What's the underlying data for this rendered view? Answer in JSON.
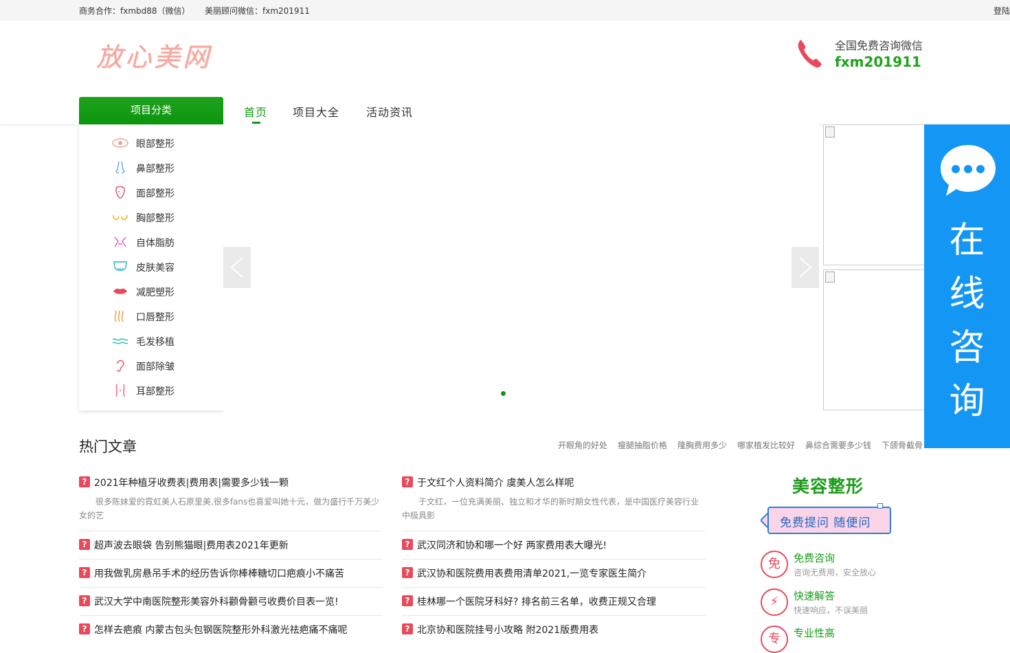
{
  "topbar": {
    "business": "商务合作：fxmbd88（微信）",
    "advisor": "美丽顾问微信：fxm201911",
    "login": "登陆"
  },
  "brand": {
    "logo_text": "放心美网"
  },
  "hotline": {
    "label": "全国免费咨询微信",
    "value": "fxm201911",
    "icon": "phone-icon"
  },
  "nav": {
    "category_head": "项目分类",
    "items": [
      {
        "label": "首页",
        "active": true
      },
      {
        "label": "项目大全",
        "active": false
      },
      {
        "label": "活动资讯",
        "active": false
      }
    ]
  },
  "categories": [
    {
      "label": "眼部整形",
      "icon": "eye-icon"
    },
    {
      "label": "鼻部整形",
      "icon": "nose-icon"
    },
    {
      "label": "面部整形",
      "icon": "face-icon"
    },
    {
      "label": "胸部整形",
      "icon": "chest-icon"
    },
    {
      "label": "自体脂肪",
      "icon": "body-fat-icon"
    },
    {
      "label": "皮肤美容",
      "icon": "skin-icon"
    },
    {
      "label": "减肥塑形",
      "icon": "lips-icon"
    },
    {
      "label": "口唇整形",
      "icon": "wave-icon"
    },
    {
      "label": "毛发移植",
      "icon": "hair-icon"
    },
    {
      "label": "面部除皱",
      "icon": "ear-icon"
    },
    {
      "label": "耳部整形",
      "icon": "figure-icon"
    }
  ],
  "float_consult": {
    "text": [
      "在",
      "线",
      "咨",
      "询"
    ],
    "icon": "chat-bubble-icon"
  },
  "hot": {
    "title": "热门文章",
    "tags": [
      "开眼角的好处",
      "瘦腿抽脂价格",
      "隆胸费用多少",
      "哪家植发比较好",
      "鼻综合需要多少钱",
      "下颌骨截骨"
    ]
  },
  "articles_left": [
    {
      "title": "2021年种植牙收费表|费用表|需要多少钱一颗",
      "desc": "很多陈妹爱的霓虹美人石原里美,很多fans也喜爱叫她十元，做为盛行千万美少女的艺"
    },
    {
      "title": "超声波去眼袋 告别熊猫眼|费用表2021年更新",
      "desc": ""
    },
    {
      "title": "用我做乳房悬吊手术的经历告诉你棒棒糖切口疤痕小不痛苦",
      "desc": ""
    },
    {
      "title": "武汉大学中南医院整形美容外科颧骨颧弓收费价目表一览!",
      "desc": ""
    },
    {
      "title": "怎样去疤痕 内蒙古包头包钢医院整形外科激光祛疤痛不痛呢",
      "desc": ""
    }
  ],
  "articles_right": [
    {
      "title": "于文红个人资料简介 虞美人怎么样呢",
      "desc": "于文红，一位充满美丽、独立和才华的新时期女性代表，是中国医疗美容行业中极具影"
    },
    {
      "title": "武汉同济和协和哪一个好 两家费用表大曝光!",
      "desc": ""
    },
    {
      "title": "武汉协和医院费用表费用清单2021,一览专家医生简介",
      "desc": ""
    },
    {
      "title": "桂林哪一个医院牙科好? 排名前三名单，收费正规又合理",
      "desc": ""
    },
    {
      "title": "北京协和医院挂号小攻略 附2021版费用表",
      "desc": ""
    }
  ],
  "beauty": {
    "title": "美容整形",
    "badge": "免费提问 随便问",
    "features": [
      {
        "icon_text": "免",
        "title": "免费咨询",
        "desc": "咨询无费用，安全放心"
      },
      {
        "icon_text": "⚡",
        "title": "快速解答",
        "desc": "快速响应，不误美丽"
      },
      {
        "icon_text": "专",
        "title": "专业性高",
        "desc": ""
      }
    ]
  },
  "colors": {
    "brand_green": "#149a14",
    "consult_blue": "#1497f4",
    "question_red": "#e8495b"
  }
}
